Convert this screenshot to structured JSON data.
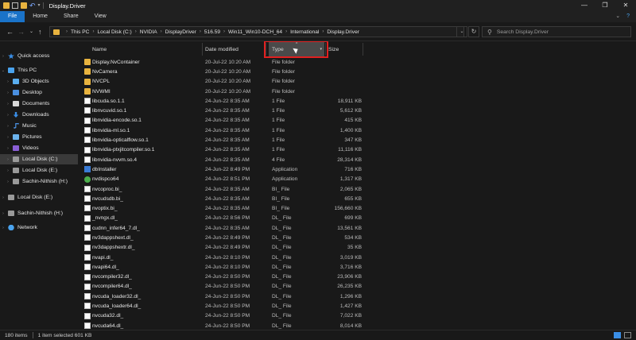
{
  "window": {
    "title": "Display.Driver"
  },
  "ribbon": {
    "tabs": [
      "File",
      "Home",
      "Share",
      "View"
    ]
  },
  "address": {
    "crumbs": [
      "This PC",
      "Local Disk (C:)",
      "NVIDIA",
      "DisplayDriver",
      "516.59",
      "Win11_Win10-DCH_64",
      "International",
      "Display.Driver"
    ]
  },
  "search": {
    "placeholder": "Search Display.Driver"
  },
  "sidebar": {
    "items": [
      {
        "label": "Quick access",
        "icon": "star-icon"
      },
      {
        "label": "This PC",
        "icon": "computer-icon"
      },
      {
        "label": "3D Objects",
        "icon": "cube-icon"
      },
      {
        "label": "Desktop",
        "icon": "desktop-icon"
      },
      {
        "label": "Documents",
        "icon": "document-icon"
      },
      {
        "label": "Downloads",
        "icon": "download-icon"
      },
      {
        "label": "Music",
        "icon": "music-icon"
      },
      {
        "label": "Pictures",
        "icon": "picture-icon"
      },
      {
        "label": "Videos",
        "icon": "video-icon"
      },
      {
        "label": "Local Disk (C:)",
        "icon": "drive-icon"
      },
      {
        "label": "Local Disk (E:)",
        "icon": "drive-icon"
      },
      {
        "label": "Sachin-Nithish (H:)",
        "icon": "drive-icon"
      },
      {
        "label": "Local Disk (E:)",
        "icon": "drive-icon"
      },
      {
        "label": "Sachin-Nithish (H:)",
        "icon": "drive-icon"
      },
      {
        "label": "Network",
        "icon": "network-icon"
      }
    ]
  },
  "columns": {
    "name": "Name",
    "date": "Date modified",
    "type": "Type",
    "size": "Size"
  },
  "files": [
    {
      "name": "Display.NvContainer",
      "date": "20-Jul-22 10:20 AM",
      "type": "File folder",
      "size": "",
      "kind": "folder"
    },
    {
      "name": "NvCamera",
      "date": "20-Jul-22 10:20 AM",
      "type": "File folder",
      "size": "",
      "kind": "folder"
    },
    {
      "name": "NVCPL",
      "date": "20-Jul-22 10:20 AM",
      "type": "File folder",
      "size": "",
      "kind": "folder"
    },
    {
      "name": "NVWMI",
      "date": "20-Jul-22 10:20 AM",
      "type": "File folder",
      "size": "",
      "kind": "folder"
    },
    {
      "name": "libcuda.so.1.1",
      "date": "24-Jun-22 8:35 AM",
      "type": "1 File",
      "size": "18,911 KB",
      "kind": "file"
    },
    {
      "name": "libnvcuvid.so.1",
      "date": "24-Jun-22 8:35 AM",
      "type": "1 File",
      "size": "5,612 KB",
      "kind": "file"
    },
    {
      "name": "libnvidia-encode.so.1",
      "date": "24-Jun-22 8:35 AM",
      "type": "1 File",
      "size": "415 KB",
      "kind": "file"
    },
    {
      "name": "libnvidia-ml.so.1",
      "date": "24-Jun-22 8:35 AM",
      "type": "1 File",
      "size": "1,400 KB",
      "kind": "file"
    },
    {
      "name": "libnvidia-opticalflow.so.1",
      "date": "24-Jun-22 8:35 AM",
      "type": "1 File",
      "size": "347 KB",
      "kind": "file"
    },
    {
      "name": "libnvidia-ptxjitcompiler.so.1",
      "date": "24-Jun-22 8:35 AM",
      "type": "1 File",
      "size": "11,116 KB",
      "kind": "file"
    },
    {
      "name": "libnvidia-nvvm.so.4",
      "date": "24-Jun-22 8:35 AM",
      "type": "4 File",
      "size": "28,314 KB",
      "kind": "file"
    },
    {
      "name": "dbInstaller",
      "date": "24-Jun-22 8:49 PM",
      "type": "Application",
      "size": "716 KB",
      "kind": "app"
    },
    {
      "name": "nvdispco64",
      "date": "24-Jun-22 8:51 PM",
      "type": "Application",
      "size": "1,317 KB",
      "kind": "app2"
    },
    {
      "name": "nvcoproc.bi_",
      "date": "24-Jun-22 8:35 AM",
      "type": "BI_ File",
      "size": "2,065 KB",
      "kind": "file"
    },
    {
      "name": "nvcudsdb.bi_",
      "date": "24-Jun-22 8:35 AM",
      "type": "BI_ File",
      "size": "655 KB",
      "kind": "file"
    },
    {
      "name": "nvoptix.bi_",
      "date": "24-Jun-22 8:35 AM",
      "type": "BI_ File",
      "size": "156,660 KB",
      "kind": "file"
    },
    {
      "name": "_nvngx.dl_",
      "date": "24-Jun-22 8:56 PM",
      "type": "DL_ File",
      "size": "699 KB",
      "kind": "file"
    },
    {
      "name": "cudnn_infer64_7.dl_",
      "date": "24-Jun-22 8:35 AM",
      "type": "DL_ File",
      "size": "13,561 KB",
      "kind": "file"
    },
    {
      "name": "nv3dappshext.dl_",
      "date": "24-Jun-22 8:49 PM",
      "type": "DL_ File",
      "size": "534 KB",
      "kind": "file"
    },
    {
      "name": "nv3dappshextr.dl_",
      "date": "24-Jun-22 8:49 PM",
      "type": "DL_ File",
      "size": "35 KB",
      "kind": "file"
    },
    {
      "name": "nvapi.dl_",
      "date": "24-Jun-22 8:10 PM",
      "type": "DL_ File",
      "size": "3,019 KB",
      "kind": "file"
    },
    {
      "name": "nvapi64.dl_",
      "date": "24-Jun-22 8:10 PM",
      "type": "DL_ File",
      "size": "3,716 KB",
      "kind": "file"
    },
    {
      "name": "nvcompiler32.dl_",
      "date": "24-Jun-22 8:50 PM",
      "type": "DL_ File",
      "size": "23,906 KB",
      "kind": "file"
    },
    {
      "name": "nvcompiler64.dl_",
      "date": "24-Jun-22 8:50 PM",
      "type": "DL_ File",
      "size": "26,235 KB",
      "kind": "file"
    },
    {
      "name": "nvcuda_loader32.dl_",
      "date": "24-Jun-22 8:50 PM",
      "type": "DL_ File",
      "size": "1,296 KB",
      "kind": "file"
    },
    {
      "name": "nvcuda_loader64.dl_",
      "date": "24-Jun-22 8:50 PM",
      "type": "DL_ File",
      "size": "1,427 KB",
      "kind": "file"
    },
    {
      "name": "nvcuda32.dl_",
      "date": "24-Jun-22 8:50 PM",
      "type": "DL_ File",
      "size": "7,022 KB",
      "kind": "file"
    },
    {
      "name": "nvcuda64.dl_",
      "date": "24-Jun-22 8:50 PM",
      "type": "DL_ File",
      "size": "8,014 KB",
      "kind": "file"
    }
  ],
  "status": {
    "items": "180 items",
    "selected": "1 item selected  601 KB"
  },
  "colors": {
    "accent": "#1a73c9",
    "highlight": "#e02020",
    "folder": "#e8b33f"
  }
}
